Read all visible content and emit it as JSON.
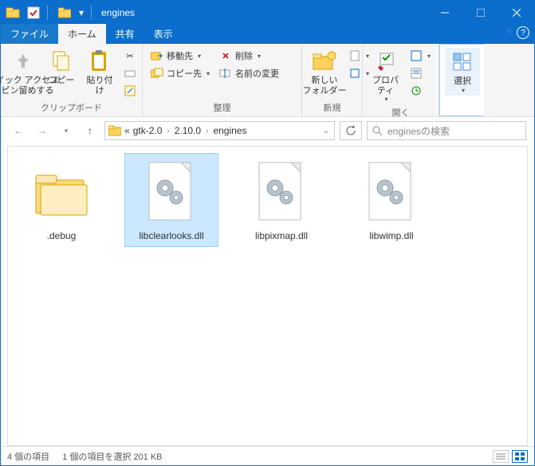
{
  "titlebar": {
    "title": "engines"
  },
  "tabs": {
    "file": "ファイル",
    "home": "ホーム",
    "share": "共有",
    "view": "表示"
  },
  "ribbon": {
    "pin": "クイック アクセス\nにピン留めする",
    "copy": "コピー",
    "paste": "貼り付け",
    "clipboard_group": "クリップボード",
    "move_to": "移動先",
    "copy_to": "コピー先",
    "delete": "削除",
    "rename": "名前の変更",
    "organize_group": "整理",
    "new_folder": "新しい\nフォルダー",
    "new_group": "新規",
    "properties": "プロパティ",
    "open_group": "開く",
    "select": "選択"
  },
  "breadcrumbs": {
    "prefix": "«",
    "items": [
      "gtk-2.0",
      "2.10.0",
      "engines"
    ]
  },
  "search": {
    "placeholder": "enginesの検索"
  },
  "items": [
    {
      "name": ".debug",
      "type": "folder",
      "selected": false
    },
    {
      "name": "libclearlooks.dll",
      "type": "dll",
      "selected": true
    },
    {
      "name": "libpixmap.dll",
      "type": "dll",
      "selected": false
    },
    {
      "name": "libwimp.dll",
      "type": "dll",
      "selected": false
    }
  ],
  "status": {
    "count": "4 個の項目",
    "selection": "1 個の項目を選択 201 KB"
  }
}
